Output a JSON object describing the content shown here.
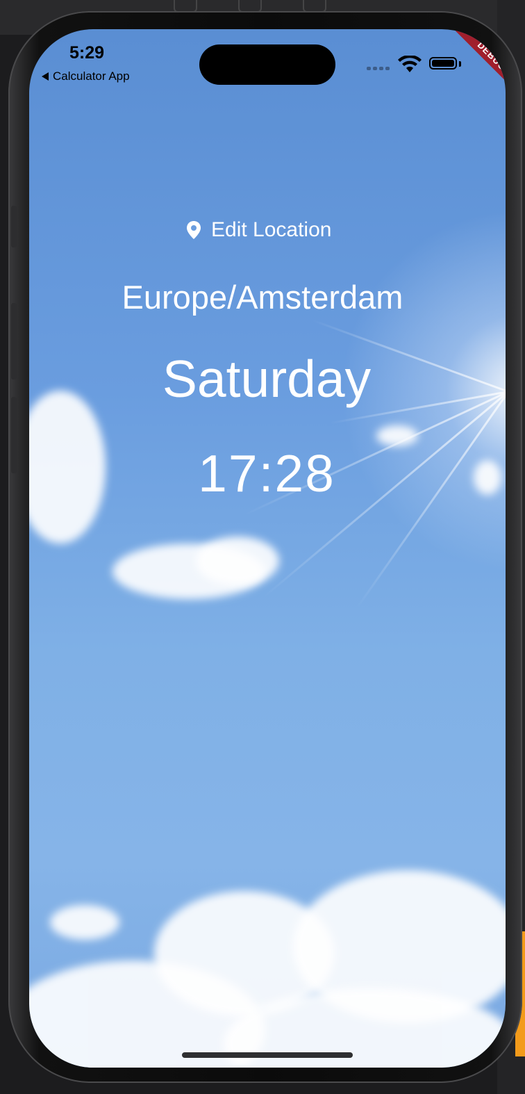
{
  "status_bar": {
    "time": "5:29",
    "back_app_label": "Calculator App",
    "wifi_icon": "wifi-icon",
    "battery_icon": "battery-icon",
    "battery_level": 1.0
  },
  "debug_banner": "DEBUG",
  "main": {
    "edit_location_label": "Edit Location",
    "location_icon": "location-pin-icon",
    "location": "Europe/Amsterdam",
    "day": "Saturday",
    "time": "17:28"
  },
  "colors": {
    "sky_top": "#5a8ed3",
    "sky_bottom": "#86b4e8",
    "text": "#ffffff",
    "debug_ribbon": "#a01f2d"
  }
}
